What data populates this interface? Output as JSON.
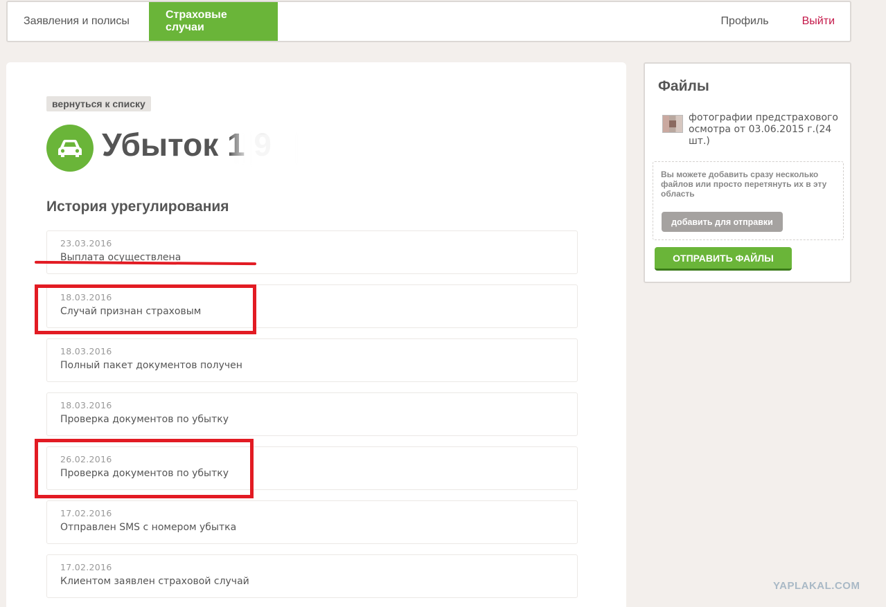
{
  "nav": {
    "tab_policies": "Заявления и полисы",
    "tab_cases": "Страховые случаи",
    "profile": "Профиль",
    "logout": "Выйти"
  },
  "main": {
    "back_label": "вернуться к списку",
    "claim_title": "Убыток 1    9",
    "claim_icon": "car-icon",
    "history_title": "История урегулирования",
    "history": [
      {
        "date": "23.03.2016",
        "text": "Выплата осуществлена"
      },
      {
        "date": "18.03.2016",
        "text": "Случай признан страховым"
      },
      {
        "date": "18.03.2016",
        "text": "Полный пакет документов получен"
      },
      {
        "date": "18.03.2016",
        "text": "Проверка документов по убытку"
      },
      {
        "date": "26.02.2016",
        "text": "Проверка документов по убытку"
      },
      {
        "date": "17.02.2016",
        "text": "Отправлен SMS с номером убытка"
      },
      {
        "date": "17.02.2016",
        "text": "Клиентом заявлен страховой случай"
      }
    ]
  },
  "files": {
    "title": "Файлы",
    "file_name": "фотографии предстрахового осмотра от 03.06.2015 г.(24 шт.)",
    "drop_hint": "Вы можете добавить сразу несколько файлов или просто перетянуть их в эту область",
    "add_button": "добавить для отправки",
    "send_button": "ОТПРАВИТЬ ФАЙЛЫ"
  },
  "watermark": "YAPLAKAL.COM",
  "colors": {
    "accent": "#6ab539",
    "logout": "#c41849",
    "annotation": "#e21b23"
  }
}
